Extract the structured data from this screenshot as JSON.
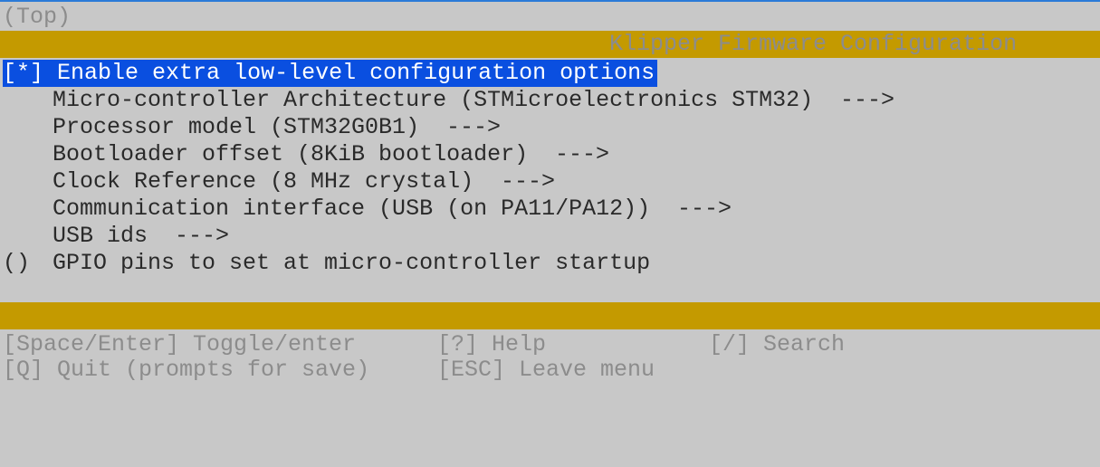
{
  "header": {
    "breadcrumb": "(Top)",
    "title": "Klipper Firmware Configuration"
  },
  "menu": {
    "items": [
      {
        "prefix": "[*]",
        "label": "Enable extra low-level configuration options",
        "selected": true
      },
      {
        "prefix": "",
        "label": "Micro-controller Architecture (STMicroelectronics STM32)",
        "arrow": "--->"
      },
      {
        "prefix": "",
        "label": "Processor model (STM32G0B1)",
        "arrow": "--->"
      },
      {
        "prefix": "",
        "label": "Bootloader offset (8KiB bootloader)",
        "arrow": "--->"
      },
      {
        "prefix": "",
        "label": "Clock Reference (8 MHz crystal)",
        "arrow": "--->"
      },
      {
        "prefix": "",
        "label": "Communication interface (USB (on PA11/PA12))",
        "arrow": "--->"
      },
      {
        "prefix": "",
        "label": "USB ids",
        "arrow": "--->"
      },
      {
        "prefix": "()",
        "label": "GPIO pins to set at micro-controller startup"
      }
    ]
  },
  "footer": {
    "keys": [
      "[Space/Enter] Toggle/enter",
      "[?] Help",
      "[/] Search",
      "[Q] Quit (prompts for save)",
      "[ESC] Leave menu"
    ]
  },
  "colors": {
    "background": "#c8c8c8",
    "bar": "#c49a00",
    "selection": "#0a4fe0",
    "window_border": "#2b7bd8"
  }
}
